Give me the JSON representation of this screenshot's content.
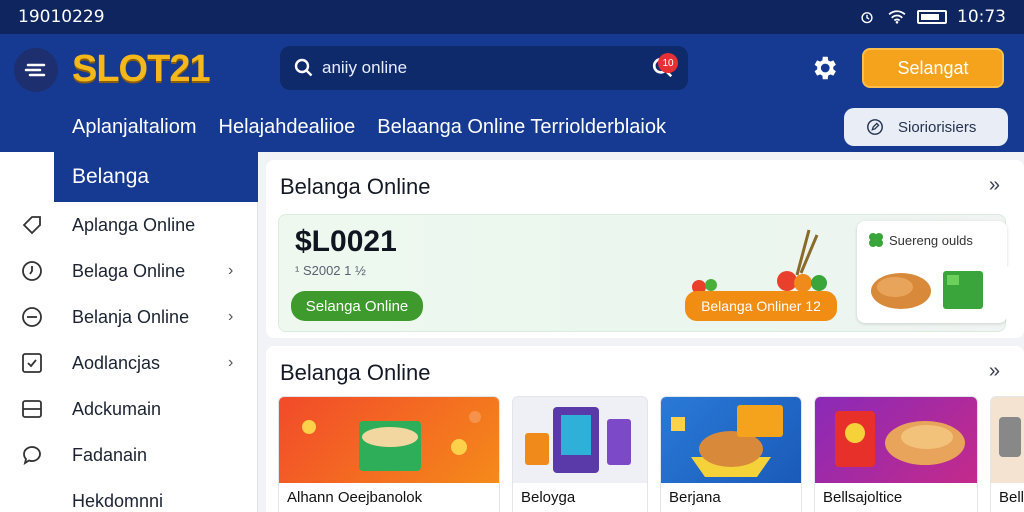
{
  "status_bar": {
    "time_left": "19010229",
    "time_right": "10:73"
  },
  "header": {
    "logo": "SLOT21",
    "search_placeholder": "aniiy online",
    "search_badge": "10",
    "cta_label": "Selangat",
    "nav": [
      "Aplanjaltaliom",
      "Helajahdealiioe",
      "Belaanga Online Terriolderblaiok"
    ],
    "pill_label": "Sioriorisiers"
  },
  "sidebar": {
    "active_label": "Belanga",
    "items": [
      {
        "label": "Aplanga Online",
        "icon": "tag-icon",
        "chevron": false
      },
      {
        "label": "Belaga Online",
        "icon": "clock-icon",
        "chevron": true
      },
      {
        "label": "Belanja Online",
        "icon": "circle-minus-icon",
        "chevron": true
      },
      {
        "label": "Aodlancjas",
        "icon": "check-box-icon",
        "chevron": true
      },
      {
        "label": "Adckumain",
        "icon": "panel-icon",
        "chevron": false
      },
      {
        "label": "Fadanain",
        "icon": "chat-icon",
        "chevron": false
      },
      {
        "label": "Hekdomnni",
        "icon": "",
        "chevron": false
      }
    ]
  },
  "section1": {
    "title": "Belanga Online",
    "more": "»",
    "banner": {
      "price": "$L0021",
      "subtext": "¹ S2002 1 ½",
      "primary_button": "Selangа Online",
      "secondary_button": "Belanga Onliner 12",
      "side_label": "Suereng oulds"
    }
  },
  "section2": {
    "title": "Belanga Online",
    "more": "»",
    "products": [
      {
        "name": "Alhann Oeejbanolok",
        "image": "snacks-box"
      },
      {
        "name": "Beloyga",
        "image": "vending-machine"
      },
      {
        "name": "Berjana",
        "image": "fried-chicken"
      },
      {
        "name": "Bellsajoltice",
        "image": "pastry"
      },
      {
        "name": "Bell",
        "image": "mixer"
      }
    ]
  },
  "colors": {
    "header": "#163a92",
    "status_bar": "#0f2560",
    "accent_orange": "#f5a21c",
    "accent_green": "#3f9a2e",
    "logo": "#f5b81c"
  }
}
